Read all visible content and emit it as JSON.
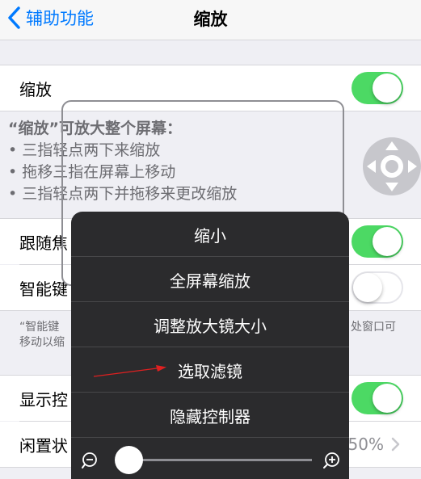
{
  "navbar": {
    "back_label": "辅助功能",
    "title": "缩放"
  },
  "zoom_cell": {
    "label": "缩放",
    "toggle_on": true
  },
  "info": {
    "heading": "“缩放”可放大整个屏幕：",
    "lines": [
      "• 三指轻点两下来缩放",
      "• 拖移三指在屏幕上移动",
      "• 三指轻点两下并拖移来更改缩放"
    ]
  },
  "follow_focus_cell": {
    "label": "跟随焦",
    "toggle_on": true
  },
  "smart_keyboard_cell": {
    "label": "智能键",
    "toggle_on": false
  },
  "footer": {
    "left_line1": "“智能键",
    "left_line2": "移动以缩",
    "right_part": "处窗口可"
  },
  "show_controller_cell": {
    "label": "显示控",
    "toggle_on": true
  },
  "idle_cell": {
    "label": "闲置状",
    "value": "50%"
  },
  "menu": {
    "items": [
      "缩小",
      "全屏幕缩放",
      "调整放大镜大小",
      "选取滤镜",
      "隐藏控制器"
    ],
    "slider_value": 0.05
  },
  "colors": {
    "accent": "#007aff",
    "toggle_on": "#4cd964",
    "menu_bg": "#2b2b2d",
    "arrow": "#e02020"
  }
}
